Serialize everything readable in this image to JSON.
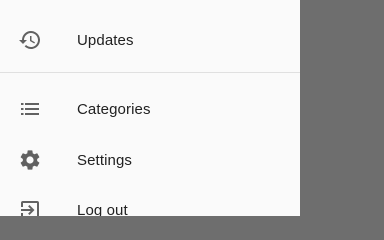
{
  "drawer": {
    "items": [
      {
        "label": "Updates",
        "icon": "history-icon"
      },
      {
        "label": "Categories",
        "icon": "list-icon"
      },
      {
        "label": "Settings",
        "icon": "gear-icon"
      },
      {
        "label": "Log out",
        "icon": "logout-icon"
      }
    ]
  },
  "colors": {
    "drawer_bg": "#fafafa",
    "scrim": "#6e6e6e",
    "icon": "#616161",
    "text": "#212121",
    "divider": "#e0e0e0"
  }
}
